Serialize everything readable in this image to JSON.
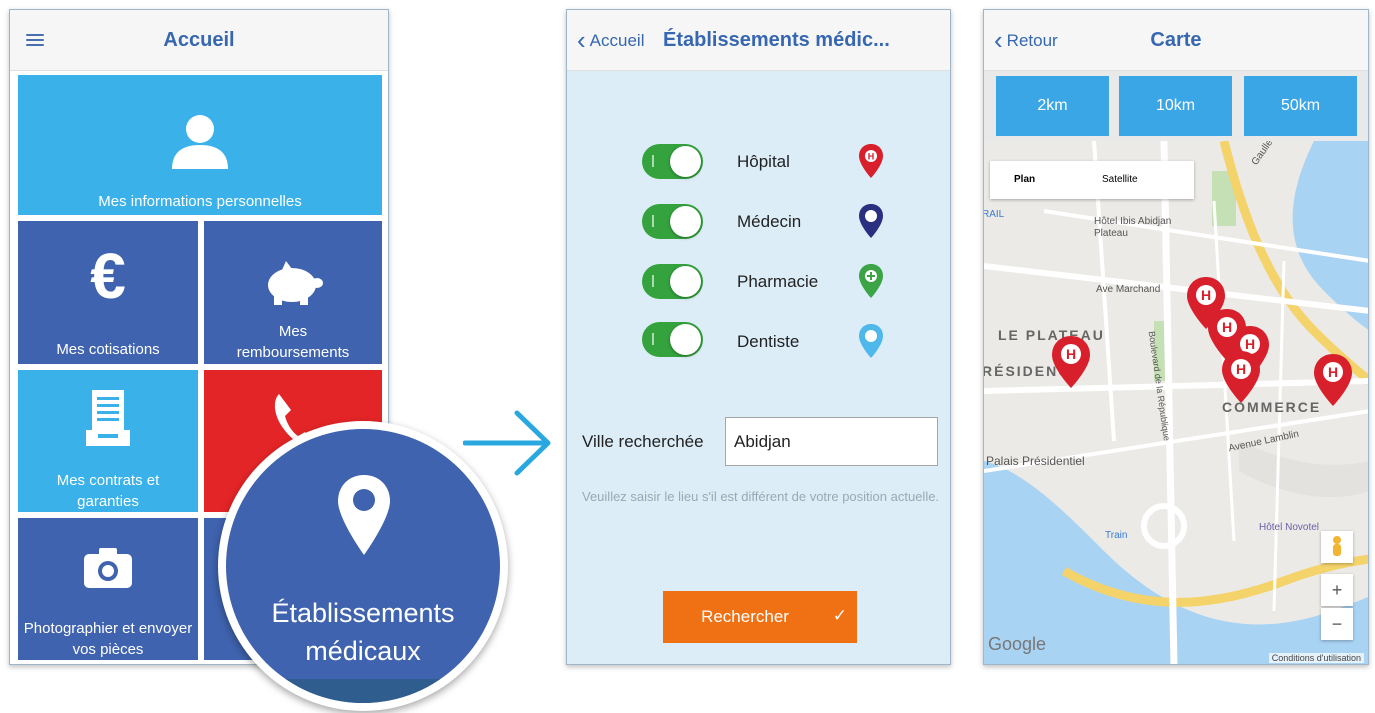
{
  "screen1": {
    "title": "Accueil",
    "tiles": {
      "personal": "Mes informations personnelles",
      "contributions": "Mes cotisations",
      "reimbursements": "Mes remboursements",
      "contracts": "Mes contrats et garanties",
      "photo": "Photographier et envoyer vos pièces"
    },
    "zoom_label": "Établissements médicaux"
  },
  "screen2": {
    "back_label": "Accueil",
    "title": "Établissements médic...",
    "categories": [
      {
        "label": "Hôpital",
        "color": "#d8202c"
      },
      {
        "label": "Médecin",
        "color": "#2b2f80"
      },
      {
        "label": "Pharmacie",
        "color": "#3aa447"
      },
      {
        "label": "Dentiste",
        "color": "#4fb8ea"
      }
    ],
    "city_label": "Ville recherchée",
    "city_value": "Abidjan",
    "hint": "Veuillez saisir le lieu s'il est différent de votre position actuelle.",
    "search_button": "Rechercher"
  },
  "screen3": {
    "back_label": "Retour",
    "title": "Carte",
    "radius_options": [
      "2km",
      "10km",
      "50km"
    ],
    "map_types": [
      "Plan",
      "Satellite"
    ],
    "map_labels": {
      "hotel_ibis": "Hôtel Ibis Abidjan Plateau",
      "ave_marchand": "Ave Marchand",
      "le_plateau": "LE PLATEAU",
      "residence": "RÉSIDENCE",
      "commerce": "COMMERCE",
      "palais": "Palais Présidentiel",
      "avenue_lamblin": "Avenue Lamblin",
      "boulevard": "Boulevard de la République",
      "train": "Train",
      "rail": "RAIL",
      "hotel_novotel": "Hôtel Novotel",
      "gaulle": "Gaulle"
    },
    "zoom_in": "+",
    "zoom_out": "−",
    "google": "Google",
    "attribution": "Conditions d'utilisation"
  },
  "colors": {
    "tile_light": "#3ab1e9",
    "tile_dark": "#3f63ae",
    "tile_red": "#e42527",
    "accent_orange": "#f07014",
    "toggle_green": "#34a33d"
  }
}
